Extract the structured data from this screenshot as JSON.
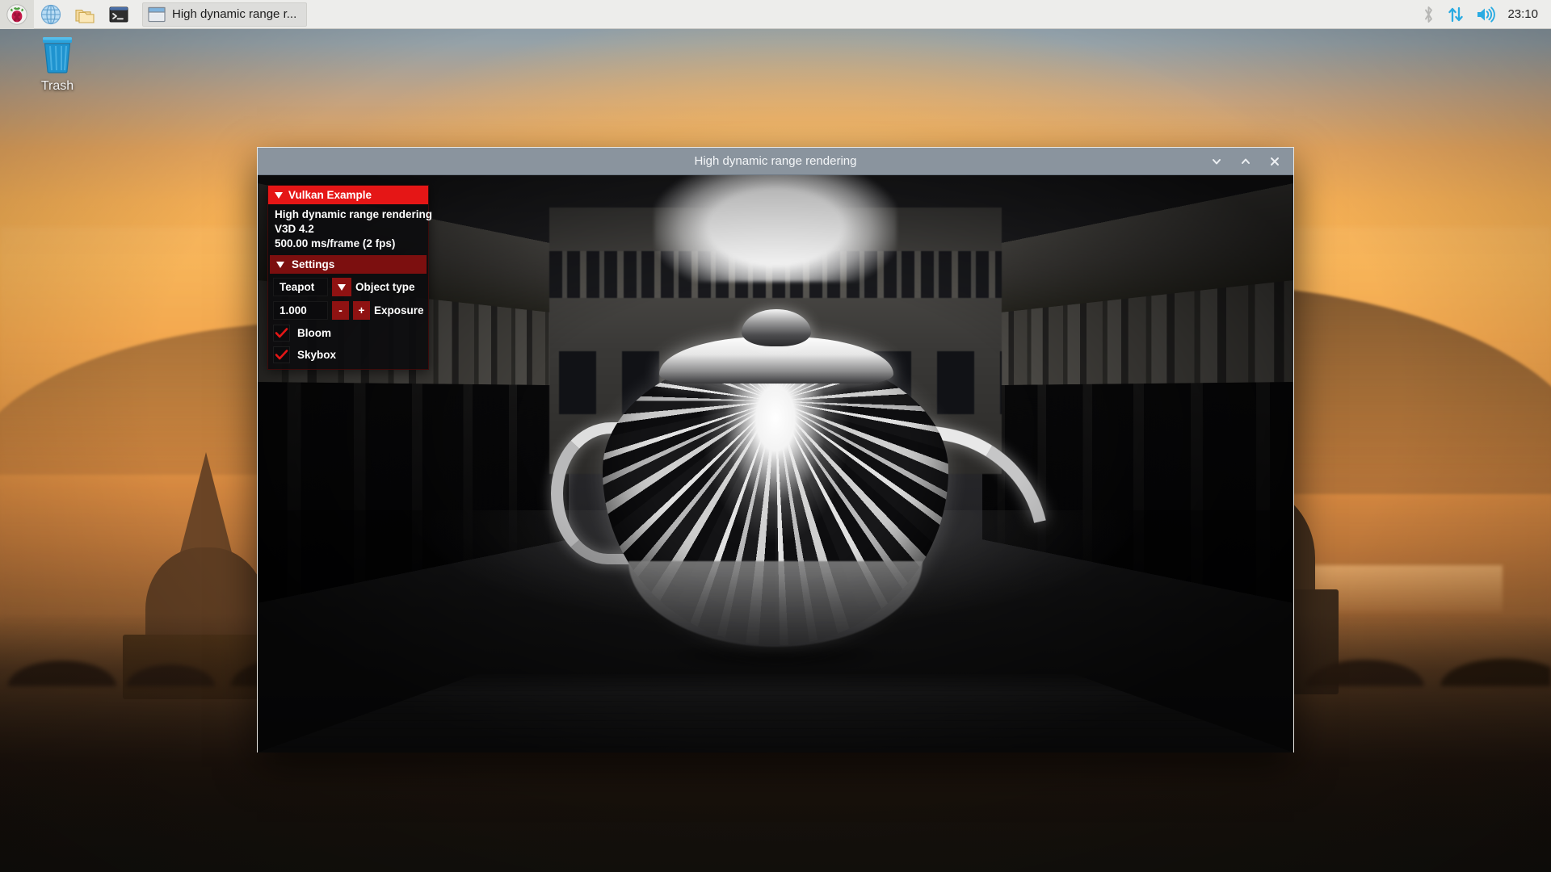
{
  "taskbar": {
    "launchers": [
      {
        "name": "raspberry-menu-icon",
        "label": "Menu"
      },
      {
        "name": "web-browser-icon",
        "label": "Web Browser"
      },
      {
        "name": "file-manager-icon",
        "label": "File Manager"
      },
      {
        "name": "terminal-icon",
        "label": "Terminal"
      }
    ],
    "window_button": {
      "label": "High dynamic range r...",
      "icon": "window-icon"
    },
    "tray": [
      {
        "name": "bluetooth-icon",
        "label": "Bluetooth"
      },
      {
        "name": "network-icon",
        "label": "Network"
      },
      {
        "name": "volume-icon",
        "label": "Volume"
      }
    ],
    "clock": "23:10"
  },
  "desktop": {
    "icons": [
      {
        "name": "trash",
        "label": "Trash"
      }
    ]
  },
  "window": {
    "title": "High dynamic range rendering",
    "controls": {
      "minimize": "minimize-icon",
      "maximize": "maximize-icon",
      "close": "close-icon"
    }
  },
  "overlay": {
    "title": "Vulkan Example",
    "stats": {
      "example_name": "High dynamic range rendering",
      "device": "V3D 4.2",
      "frame_time": "500.00 ms/frame (2 fps)"
    },
    "settings_header": "Settings",
    "object_type": {
      "value": "Teapot",
      "label": "Object type",
      "dropdown_icon": "chevron-down-icon"
    },
    "exposure": {
      "value": "1.000",
      "label": "Exposure",
      "decrement": "-",
      "increment": "+"
    },
    "checkboxes": [
      {
        "label": "Bloom",
        "checked": true
      },
      {
        "label": "Skybox",
        "checked": true
      }
    ]
  },
  "colors": {
    "imgui_accent": "#e51616",
    "imgui_header": "#7c0f0f",
    "imgui_bg": "#0c0c0e",
    "titlebar": "#8a949e",
    "taskbar": "#ededeb",
    "tray_blue": "#29abe2"
  }
}
